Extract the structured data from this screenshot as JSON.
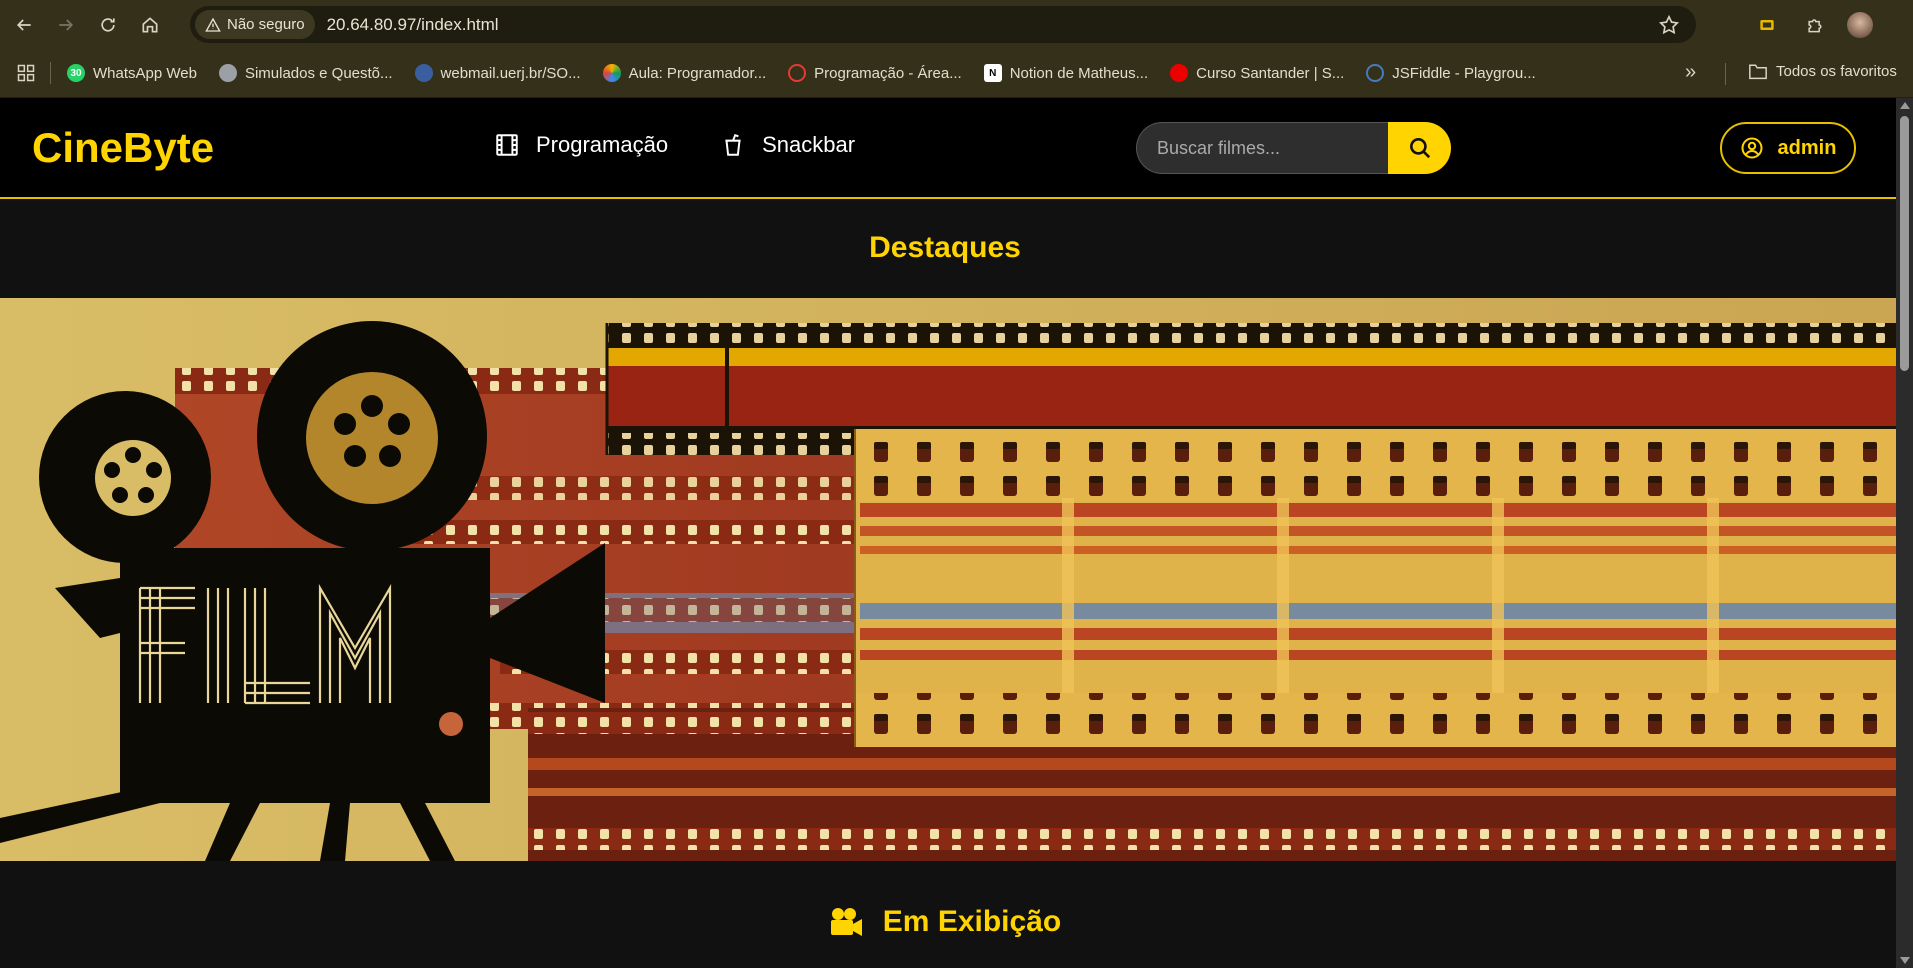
{
  "browser": {
    "security_label": "Não seguro",
    "url": "20.64.80.97/index.html",
    "bookmarks": [
      {
        "label": "WhatsApp Web",
        "icon": "whatsapp-icon",
        "color": "#25d366"
      },
      {
        "label": "Simulados e Questõ...",
        "icon": "globe-icon",
        "color": "#9aa0a6"
      },
      {
        "label": "webmail.uerj.br/SO...",
        "icon": "webmail-icon",
        "color": "#3a7bd5"
      },
      {
        "label": "Aula: Programador...",
        "icon": "aula-icon",
        "color": "#f4b400"
      },
      {
        "label": "Programação - Área...",
        "icon": "programacao-icon",
        "color": "#e53935"
      },
      {
        "label": "Notion de Matheus...",
        "icon": "notion-icon",
        "color": "#ffffff"
      },
      {
        "label": "Curso Santander | S...",
        "icon": "santander-icon",
        "color": "#ec0000"
      },
      {
        "label": "JSFiddle - Playgrou...",
        "icon": "jsfiddle-icon",
        "color": "#4679bd"
      }
    ],
    "all_bookmarks_label": "Todos os favoritos"
  },
  "site": {
    "logo": "CineByte",
    "menu": [
      {
        "label": "Programação",
        "icon": "film-icon"
      },
      {
        "label": "Snackbar",
        "icon": "cup-icon"
      }
    ],
    "search": {
      "placeholder": "Buscar filmes..."
    },
    "user": {
      "label": "admin",
      "icon": "user-circle-icon"
    },
    "highlights_title": "Destaques",
    "banner": {
      "alt": "FILM"
    },
    "now_showing_title": "Em Exibição",
    "accent_color": "#ffd400"
  }
}
